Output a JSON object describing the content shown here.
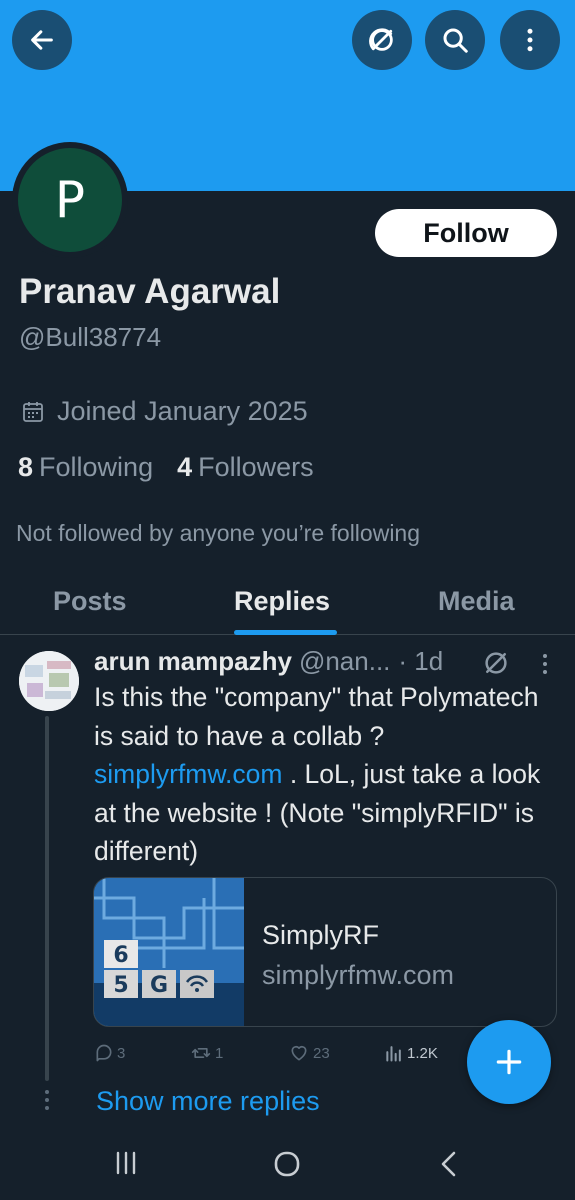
{
  "header": {
    "back_icon": "back-arrow-icon",
    "grok_icon": "grok-icon",
    "search_icon": "search-icon",
    "more_icon": "more-vertical-icon"
  },
  "profile": {
    "avatar_letter": "P",
    "follow_label": "Follow",
    "name": "Pranav Agarwal",
    "handle": "@Bull38774",
    "joined": "Joined January 2025",
    "following_count": "8",
    "following_label": "Following",
    "followers_count": "4",
    "followers_label": "Followers",
    "not_followed": "Not followed by anyone you’re following"
  },
  "tabs": [
    {
      "label": "Posts",
      "active": false
    },
    {
      "label": "Replies",
      "active": true
    },
    {
      "label": "Media",
      "active": false
    }
  ],
  "tweet": {
    "author_name": "arun mampazhy",
    "author_handle": "@nan...",
    "time": "· 1d",
    "text_part1": "Is this the \"company\" that Polymatech is said to have a collab ? ",
    "text_link": "simplyrfmw.com",
    "text_part2": " . LoL, just take a look at the website ! (Note \"simplyRFID\" is different)",
    "card": {
      "title": "SimplyRF",
      "domain": "simplyrfmw.com",
      "image_text_top": "6",
      "image_text_bottom": "5",
      "image_text_g": "G"
    },
    "actions": {
      "replies": "3",
      "reposts": "1",
      "likes": "23",
      "views": "1.2K"
    }
  },
  "show_more": "Show more replies",
  "colors": {
    "banner": "#1d9bf0",
    "background": "#15202b",
    "accent": "#1d9bf0",
    "avatar_bg": "#0f4d3a"
  }
}
